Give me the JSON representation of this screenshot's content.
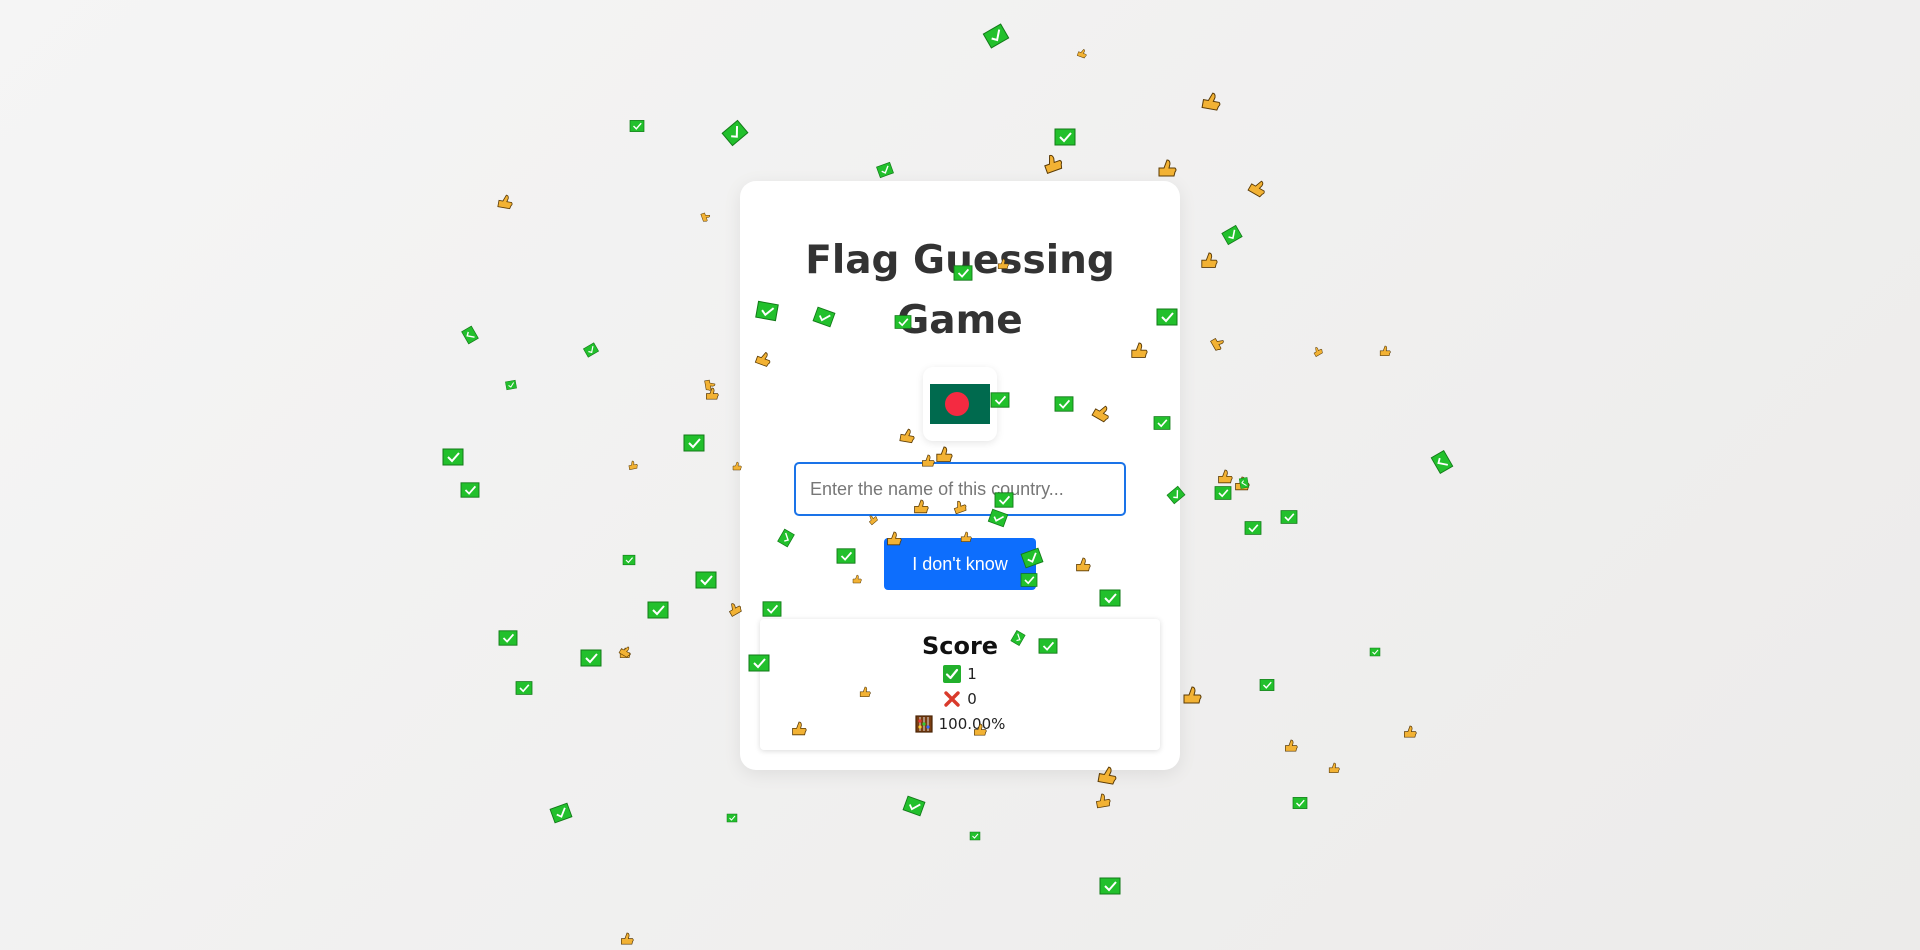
{
  "game": {
    "title": "Flag Guessing Game",
    "flag_icon": "flag-of-bangladesh",
    "input_placeholder": "Enter the name of this country...",
    "input_value": "",
    "dont_know_label": "I don't know"
  },
  "score": {
    "title": "Score",
    "correct": "1",
    "incorrect": "0",
    "accuracy": "100.00%",
    "correct_icon": "check-box-icon",
    "incorrect_icon": "cross-mark-icon",
    "accuracy_icon": "abacus-icon"
  },
  "colors": {
    "accent": "#0d6efd",
    "input_border": "#1a73e8",
    "flag_green": "#006a4e",
    "flag_red": "#f42a41",
    "confetti_green": "#22c02c",
    "confetti_yellow": "#f2b234"
  }
}
